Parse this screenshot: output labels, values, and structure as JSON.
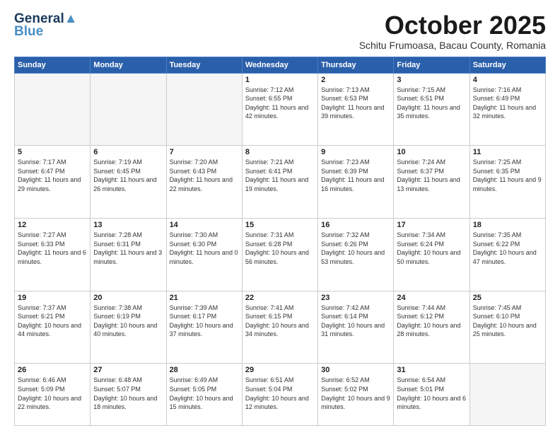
{
  "header": {
    "logo_line1": "General",
    "logo_line2": "Blue",
    "month": "October 2025",
    "location": "Schitu Frumoasa, Bacau County, Romania"
  },
  "weekdays": [
    "Sunday",
    "Monday",
    "Tuesday",
    "Wednesday",
    "Thursday",
    "Friday",
    "Saturday"
  ],
  "weeks": [
    [
      {
        "day": "",
        "empty": true
      },
      {
        "day": "",
        "empty": true
      },
      {
        "day": "",
        "empty": true
      },
      {
        "day": "1",
        "sunrise": "7:12 AM",
        "sunset": "6:55 PM",
        "daylight": "11 hours and 42 minutes."
      },
      {
        "day": "2",
        "sunrise": "7:13 AM",
        "sunset": "6:53 PM",
        "daylight": "11 hours and 39 minutes."
      },
      {
        "day": "3",
        "sunrise": "7:15 AM",
        "sunset": "6:51 PM",
        "daylight": "11 hours and 35 minutes."
      },
      {
        "day": "4",
        "sunrise": "7:16 AM",
        "sunset": "6:49 PM",
        "daylight": "11 hours and 32 minutes."
      }
    ],
    [
      {
        "day": "5",
        "sunrise": "7:17 AM",
        "sunset": "6:47 PM",
        "daylight": "11 hours and 29 minutes."
      },
      {
        "day": "6",
        "sunrise": "7:19 AM",
        "sunset": "6:45 PM",
        "daylight": "11 hours and 26 minutes."
      },
      {
        "day": "7",
        "sunrise": "7:20 AM",
        "sunset": "6:43 PM",
        "daylight": "11 hours and 22 minutes."
      },
      {
        "day": "8",
        "sunrise": "7:21 AM",
        "sunset": "6:41 PM",
        "daylight": "11 hours and 19 minutes."
      },
      {
        "day": "9",
        "sunrise": "7:23 AM",
        "sunset": "6:39 PM",
        "daylight": "11 hours and 16 minutes."
      },
      {
        "day": "10",
        "sunrise": "7:24 AM",
        "sunset": "6:37 PM",
        "daylight": "11 hours and 13 minutes."
      },
      {
        "day": "11",
        "sunrise": "7:25 AM",
        "sunset": "6:35 PM",
        "daylight": "11 hours and 9 minutes."
      }
    ],
    [
      {
        "day": "12",
        "sunrise": "7:27 AM",
        "sunset": "6:33 PM",
        "daylight": "11 hours and 6 minutes."
      },
      {
        "day": "13",
        "sunrise": "7:28 AM",
        "sunset": "6:31 PM",
        "daylight": "11 hours and 3 minutes."
      },
      {
        "day": "14",
        "sunrise": "7:30 AM",
        "sunset": "6:30 PM",
        "daylight": "11 hours and 0 minutes."
      },
      {
        "day": "15",
        "sunrise": "7:31 AM",
        "sunset": "6:28 PM",
        "daylight": "10 hours and 56 minutes."
      },
      {
        "day": "16",
        "sunrise": "7:32 AM",
        "sunset": "6:26 PM",
        "daylight": "10 hours and 53 minutes."
      },
      {
        "day": "17",
        "sunrise": "7:34 AM",
        "sunset": "6:24 PM",
        "daylight": "10 hours and 50 minutes."
      },
      {
        "day": "18",
        "sunrise": "7:35 AM",
        "sunset": "6:22 PM",
        "daylight": "10 hours and 47 minutes."
      }
    ],
    [
      {
        "day": "19",
        "sunrise": "7:37 AM",
        "sunset": "6:21 PM",
        "daylight": "10 hours and 44 minutes."
      },
      {
        "day": "20",
        "sunrise": "7:38 AM",
        "sunset": "6:19 PM",
        "daylight": "10 hours and 40 minutes."
      },
      {
        "day": "21",
        "sunrise": "7:39 AM",
        "sunset": "6:17 PM",
        "daylight": "10 hours and 37 minutes."
      },
      {
        "day": "22",
        "sunrise": "7:41 AM",
        "sunset": "6:15 PM",
        "daylight": "10 hours and 34 minutes."
      },
      {
        "day": "23",
        "sunrise": "7:42 AM",
        "sunset": "6:14 PM",
        "daylight": "10 hours and 31 minutes."
      },
      {
        "day": "24",
        "sunrise": "7:44 AM",
        "sunset": "6:12 PM",
        "daylight": "10 hours and 28 minutes."
      },
      {
        "day": "25",
        "sunrise": "7:45 AM",
        "sunset": "6:10 PM",
        "daylight": "10 hours and 25 minutes."
      }
    ],
    [
      {
        "day": "26",
        "sunrise": "6:46 AM",
        "sunset": "5:09 PM",
        "daylight": "10 hours and 22 minutes."
      },
      {
        "day": "27",
        "sunrise": "6:48 AM",
        "sunset": "5:07 PM",
        "daylight": "10 hours and 18 minutes."
      },
      {
        "day": "28",
        "sunrise": "6:49 AM",
        "sunset": "5:05 PM",
        "daylight": "10 hours and 15 minutes."
      },
      {
        "day": "29",
        "sunrise": "6:51 AM",
        "sunset": "5:04 PM",
        "daylight": "10 hours and 12 minutes."
      },
      {
        "day": "30",
        "sunrise": "6:52 AM",
        "sunset": "5:02 PM",
        "daylight": "10 hours and 9 minutes."
      },
      {
        "day": "31",
        "sunrise": "6:54 AM",
        "sunset": "5:01 PM",
        "daylight": "10 hours and 6 minutes."
      },
      {
        "day": "",
        "empty": true
      }
    ]
  ]
}
